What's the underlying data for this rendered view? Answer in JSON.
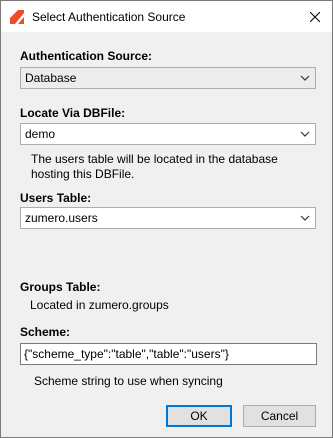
{
  "window": {
    "title": "Select Authentication Source",
    "accent_color": "#ef4b25"
  },
  "auth_source": {
    "label": "Authentication Source:",
    "selected": "Database"
  },
  "locate_via": {
    "label": "Locate Via DBFile:",
    "selected": "demo",
    "note_line1": "The users table will be located in the database",
    "note_line2": "hosting this DBFile."
  },
  "users_table": {
    "label": "Users Table:",
    "selected": "zumero.users"
  },
  "groups_table": {
    "label": "Groups Table:",
    "note": "Located in zumero.groups"
  },
  "scheme": {
    "label": "Scheme:",
    "value": "{\"scheme_type\":\"table\",\"table\":\"users\"}",
    "note": "Scheme string to use when syncing"
  },
  "buttons": {
    "ok": "OK",
    "cancel": "Cancel"
  }
}
